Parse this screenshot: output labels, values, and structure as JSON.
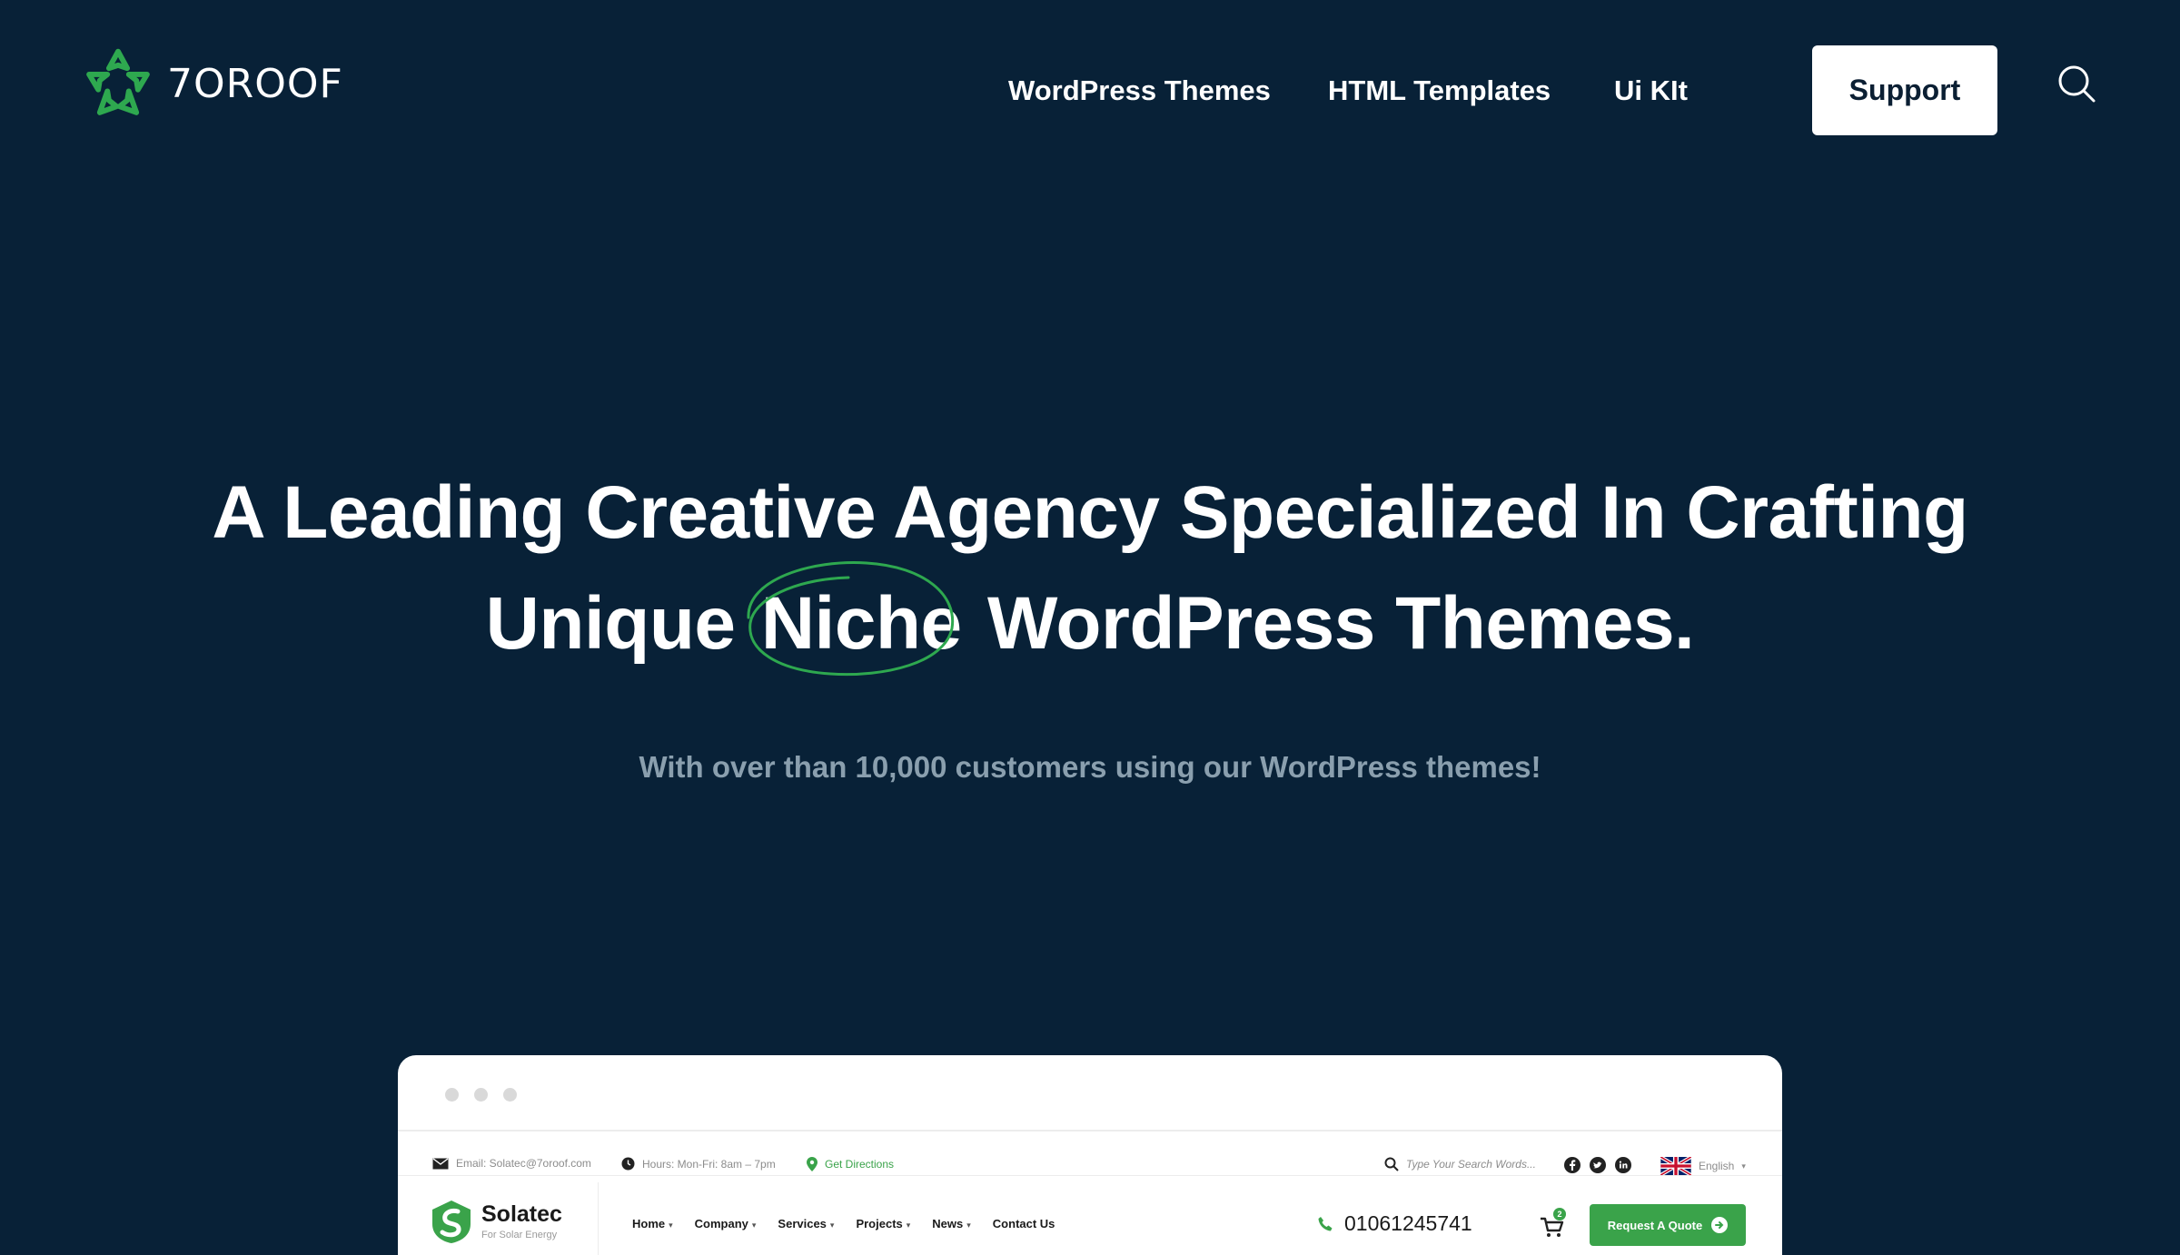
{
  "brand": {
    "name": "7OROOF",
    "accent": "#2ea84f"
  },
  "nav": {
    "items": [
      {
        "label": "WordPress Themes"
      },
      {
        "label": "HTML Templates"
      },
      {
        "label": "Ui KIt"
      }
    ],
    "support_label": "Support",
    "search_icon": "search-icon"
  },
  "hero": {
    "line1": "A Leading Creative Agency Specialized In Crafting",
    "line2_before": "Unique",
    "line2_highlight": "Niche",
    "line2_after": "WordPress Themes.",
    "subtitle": "With over than 10,000 customers using our WordPress themes!"
  },
  "preview": {
    "topbar": {
      "email": "Email: Solatec@7oroof.com",
      "hours": "Hours: Mon-Fri: 8am – 7pm",
      "directions": "Get Directions",
      "search_placeholder": "Type Your Search Words...",
      "language": "English"
    },
    "site": {
      "name": "Solatec",
      "tagline": "For Solar Energy",
      "menu": [
        "Home",
        "Company",
        "Services",
        "Projects",
        "News",
        "Contact Us"
      ],
      "phone": "01061245741",
      "cart_count": "2",
      "cta": "Request A Quote",
      "accent": "#3aa34a"
    }
  },
  "colors": {
    "background": "#082137",
    "subtitle": "#8a9fae",
    "button_bg": "#ffffff"
  }
}
